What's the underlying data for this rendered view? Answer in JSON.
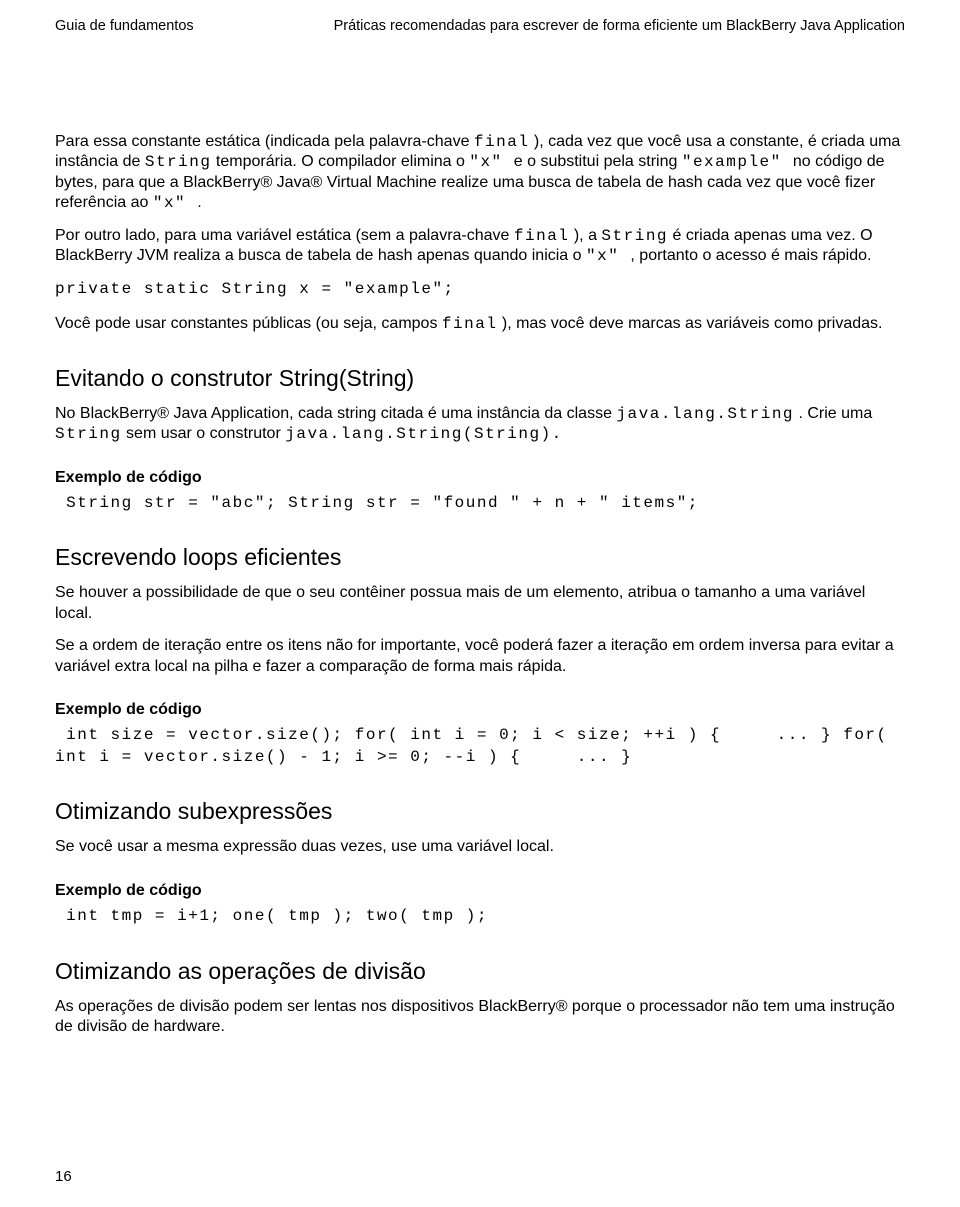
{
  "header": {
    "left": "Guia de fundamentos",
    "right": "Práticas recomendadas para escrever de forma eficiente um BlackBerry Java Application"
  },
  "intro": {
    "p1_a": "Para essa constante estática (indicada pela palavra-chave ",
    "p1_code1": "final",
    "p1_b": " ), cada vez que você usa a constante, é criada uma instância de ",
    "p1_code2": "String",
    "p1_c": " temporária. O compilador elimina o ",
    "p1_code3": " \"x\" ",
    "p1_d": " e o substitui pela string ",
    "p1_code4": " \"example\" ",
    "p1_e": " no código de bytes, para que a BlackBerry® Java® Virtual Machine realize uma busca de tabela de hash cada vez que você fizer referência ao ",
    "p1_code5": " \"x\" ",
    "p1_f": ".",
    "p2_a": "Por outro lado, para uma variável estática (sem a palavra-chave ",
    "p2_code1": "final",
    "p2_b": " ), a ",
    "p2_code2": "String",
    "p2_c": " é criada apenas uma vez. O BlackBerry JVM realiza a busca de tabela de hash apenas quando inicia o ",
    "p2_code3": " \"x\" ",
    "p2_d": " , portanto o acesso é mais rápido.",
    "code1": "private static String x = \"example\";",
    "p3_a": "Você pode usar constantes públicas (ou seja, campos ",
    "p3_code1": "final",
    "p3_b": " ), mas você deve marcas as variáveis como privadas."
  },
  "sec1": {
    "title": "Evitando o construtor String(String)",
    "p_a": "No BlackBerry® Java Application, cada string citada é uma instância da classe ",
    "p_code1": "java.lang.String",
    "p_b": " . Crie uma ",
    "p_code2": "String",
    "p_c": " sem usar o construtor ",
    "p_code3": "java.lang.String(String).",
    "ex_label": "Exemplo de código",
    "ex_code": " String str = \"abc\"; String str = \"found \" + n + \" items\";"
  },
  "sec2": {
    "title": "Escrevendo loops eficientes",
    "p1": "Se houver a possibilidade de que o seu contêiner possua mais de um elemento, atribua o tamanho a uma variável local.",
    "p2": "Se a ordem de iteração entre os itens não for importante, você poderá fazer a iteração em ordem inversa para evitar a variável extra local na pilha e fazer a comparação de forma mais rápida.",
    "ex_label": "Exemplo de código",
    "ex_code": " int size = vector.size(); for( int i = 0; i < size; ++i ) {     ... } for( int i = vector.size() - 1; i >= 0; --i ) {     ... }"
  },
  "sec3": {
    "title": "Otimizando subexpressões",
    "p1": "Se você usar a mesma expressão duas vezes, use uma variável local.",
    "ex_label": "Exemplo de código",
    "ex_code": " int tmp = i+1; one( tmp ); two( tmp );"
  },
  "sec4": {
    "title": "Otimizando as operações de divisão",
    "p1": "As operações de divisão podem ser lentas nos dispositivos BlackBerry® porque o processador não tem uma instrução de divisão de hardware."
  },
  "page_number": "16"
}
